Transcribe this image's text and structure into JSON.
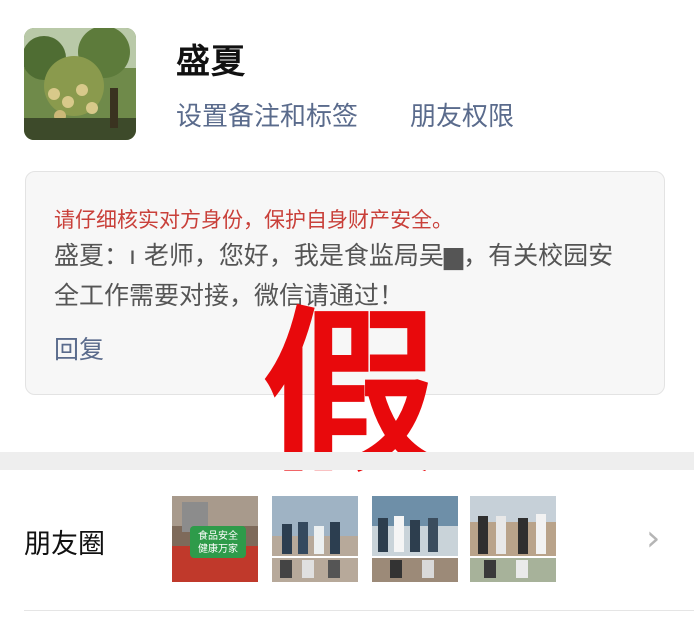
{
  "profile": {
    "name": "盛夏",
    "set_remark_label": "设置备注和标签",
    "friend_permission_label": "朋友权限"
  },
  "friend_request": {
    "warning": "请仔细核实对方身份，保护自身财产安全。",
    "message": "盛夏：ı  老师，您好，我是食监局吴▆，有关校园安全工作需要对接，微信请通过！",
    "reply_label": "回复"
  },
  "stamp": {
    "text": "假",
    "color": "#e8090c"
  },
  "moments": {
    "label": "朋友圈",
    "thumbnail_sign_text": [
      "食品安全",
      "健康万家"
    ],
    "chevron": "›"
  },
  "colors": {
    "link": "#5a6b8c",
    "warning": "#c9403a",
    "card_bg": "#f7f7f7"
  }
}
